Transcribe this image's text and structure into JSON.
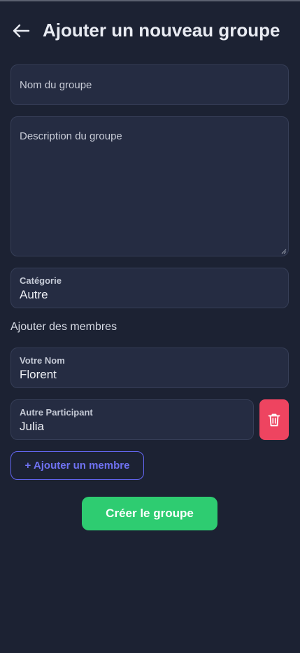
{
  "header": {
    "title": "Ajouter un nouveau groupe"
  },
  "form": {
    "group_name_placeholder": "Nom du groupe",
    "group_description_placeholder": "Description du groupe",
    "category": {
      "label": "Catégorie",
      "value": "Autre"
    },
    "members_section_label": "Ajouter des membres",
    "your_name": {
      "label": "Votre Nom",
      "value": "Florent"
    },
    "other_participant": {
      "label": "Autre Participant",
      "value": "Julia"
    },
    "add_member_label": "+ Ajouter un membre",
    "create_button_label": "Créer le groupe"
  },
  "colors": {
    "background": "#1c2233",
    "field_background": "#252c42",
    "accent_indigo": "#6366f1",
    "danger": "#ee4460",
    "success": "#2ecc71"
  },
  "icons": {
    "back": "arrow-left-icon",
    "delete": "trash-icon"
  }
}
